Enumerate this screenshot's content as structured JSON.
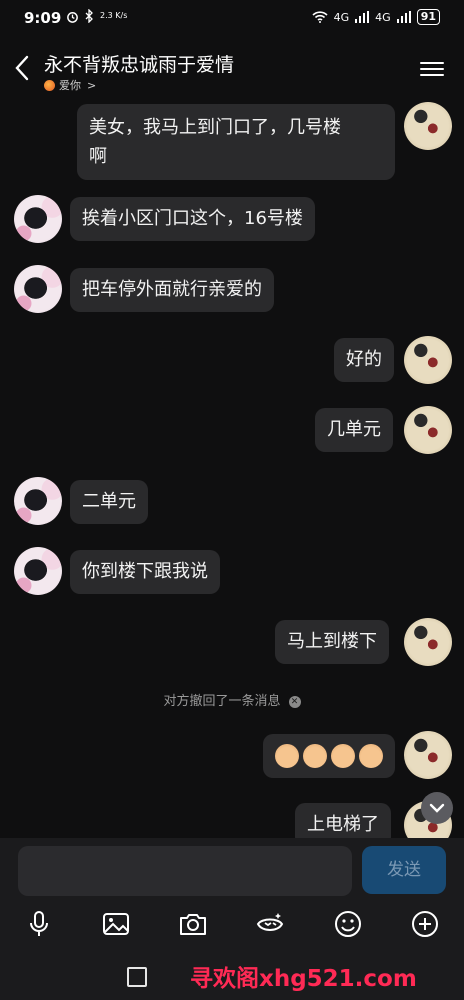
{
  "status_bar": {
    "time": "9:09",
    "speed": "2.3 K/s",
    "network_1": "4G",
    "network_2": "4G",
    "battery": "91"
  },
  "header": {
    "title": "永不背叛忠诚雨于爱情",
    "subtitle": "爱你",
    "subtitle_arrow": ">"
  },
  "messages": [
    {
      "from": "me",
      "text_line1": "美女，我马上到门口了，几号楼",
      "text_line2": "啊"
    },
    {
      "from": "other",
      "text": "挨着小区门口这个，16号楼"
    },
    {
      "from": "other",
      "text": "把车停外面就行亲爱的"
    },
    {
      "from": "me",
      "text": "好的"
    },
    {
      "from": "me",
      "text": "几单元"
    },
    {
      "from": "other",
      "text": "二单元"
    },
    {
      "from": "other",
      "text": "你到楼下跟我说"
    },
    {
      "from": "me",
      "text": "马上到楼下"
    },
    {
      "from": "me",
      "type": "emoji",
      "emoji_name": "ok-hand",
      "count": 4
    },
    {
      "from": "me",
      "text": "上电梯了"
    }
  ],
  "recall_notice": "对方撤回了一条消息",
  "input": {
    "placeholder": "",
    "send_label": "发送"
  },
  "toolbar": {
    "icons": [
      "microphone-icon",
      "image-icon",
      "camera-icon",
      "sticker-icon",
      "emoji-icon",
      "plus-icon"
    ]
  },
  "watermark": "寻欢阁xhg521.com",
  "colors": {
    "background": "#0f0f10",
    "bubble": "#2a2a2c",
    "send_button": "#184a74",
    "watermark": "#ff2a55"
  }
}
